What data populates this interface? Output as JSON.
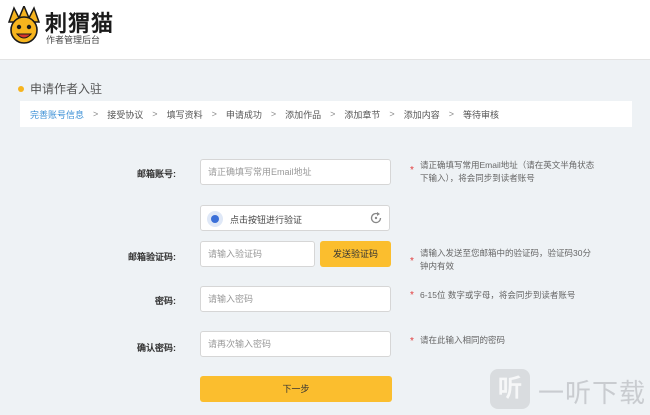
{
  "header": {
    "brand_name": "刺猬猫",
    "brand_sub": "作者管理后台",
    "logo": "hedgehog-cat-logo"
  },
  "section": {
    "title": "申请作者入驻"
  },
  "steps": [
    {
      "label": "完善账号信息",
      "active": true
    },
    {
      "label": "接受协议"
    },
    {
      "label": "填写资料"
    },
    {
      "label": "申请成功"
    },
    {
      "label": "添加作品"
    },
    {
      "label": "添加章节"
    },
    {
      "label": "添加内容"
    },
    {
      "label": "等待审核"
    }
  ],
  "step_separator": ">",
  "form": {
    "email": {
      "label": "邮箱账号:",
      "placeholder": "请正确填写常用Email地址",
      "hint_line1": "请正确填写常用Email地址（请在英文半角状态",
      "hint_line2": "下输入），将会同步到读者账号"
    },
    "captcha": {
      "text": "点击按钮进行验证",
      "icon": "refresh-icon"
    },
    "code": {
      "label": "邮箱验证码:",
      "placeholder": "请输入验证码",
      "send_button": "发送验证码",
      "hint_line1": "请输入发送至您邮箱中的验证码，验证码30分",
      "hint_line2": "钟内有效"
    },
    "password": {
      "label": "密码:",
      "placeholder": "请输入密码",
      "hint_line1": "6-15位 数字或字母，将会同步到读者账号"
    },
    "confirm": {
      "label": "确认密码:",
      "placeholder": "请再次输入密码",
      "hint_line1": "请在此输入相同的密码"
    },
    "required_mark": "*",
    "next_button": "下一步"
  },
  "watermark": {
    "icon_glyph": "听",
    "text": "一听下载"
  },
  "colors": {
    "accent": "#fbbe2e",
    "active_step": "#3a8fd6",
    "required": "#e23b3b",
    "background": "#eef2f5"
  }
}
